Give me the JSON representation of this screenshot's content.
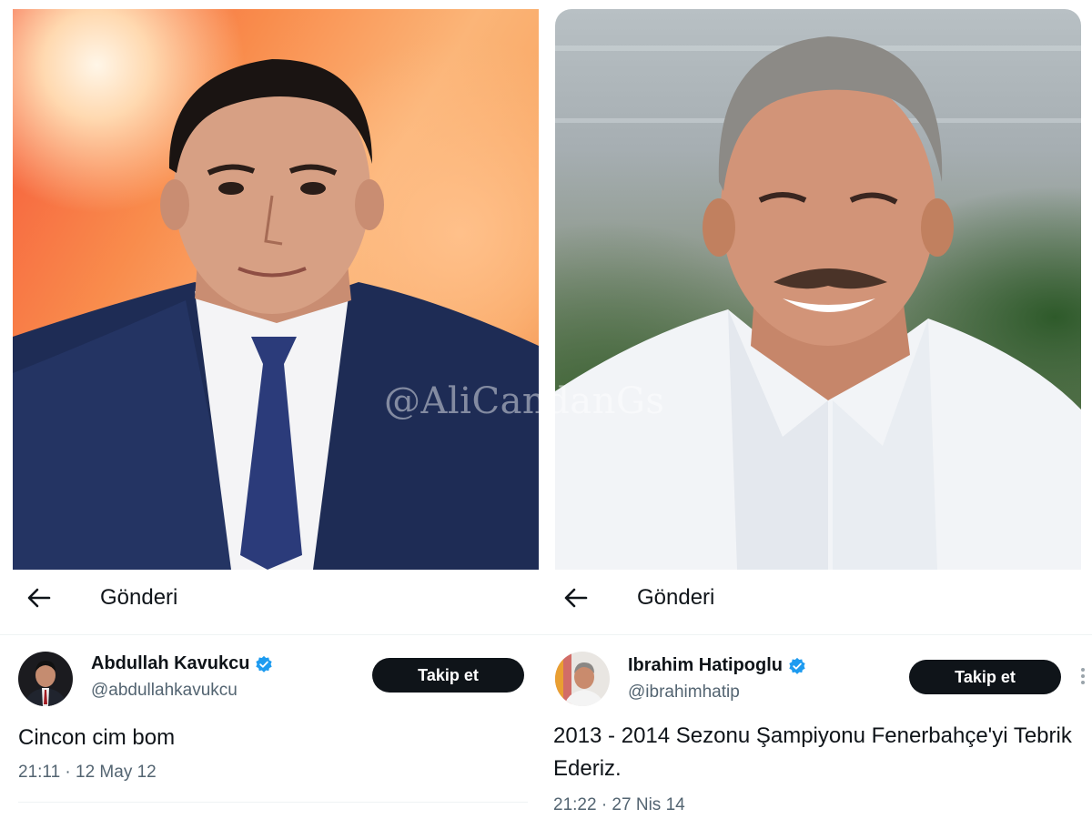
{
  "watermark": "@AliCandanGs",
  "left": {
    "header_title": "Gönderi",
    "display_name": "Abdullah Kavukcu",
    "handle": "@abdullahkavukcu",
    "follow_label": "Takip et",
    "tweet_text": "Cincon cim bom",
    "timestamp": "21:11 · 12 May 12"
  },
  "right": {
    "header_title": "Gönderi",
    "display_name": "Ibrahim Hatipoglu",
    "handle": "@ibrahimhatip",
    "follow_label": "Takip et",
    "tweet_text": "2013 - 2014 Sezonu Şampiyonu Fenerbahçe'yi Tebrik Ederiz.",
    "timestamp": "21:22 · 27 Nis 14"
  },
  "colors": {
    "verified": "#1d9bf0",
    "follow_bg": "#0f1419",
    "secondary_text": "#536471"
  },
  "icons": [
    "back-arrow-icon",
    "verified-badge-icon",
    "more-options-icon"
  ]
}
